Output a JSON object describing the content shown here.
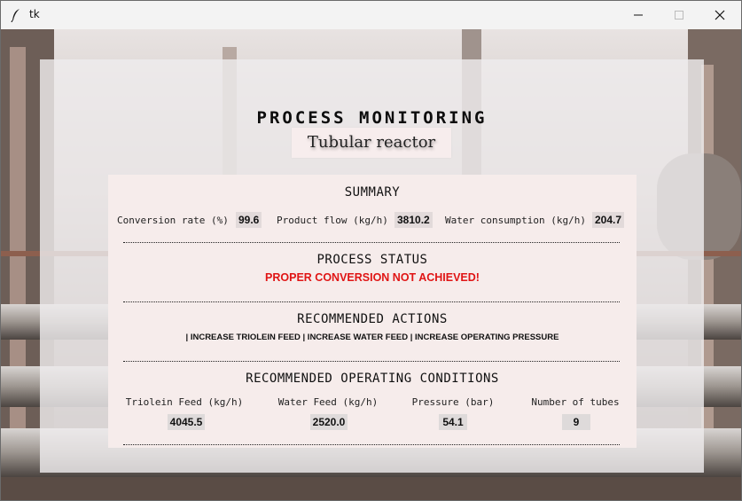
{
  "window": {
    "title": "tk"
  },
  "header": {
    "title": "PROCESS MONITORING",
    "reactor": "Tubular reactor"
  },
  "summary": {
    "title": "SUMMARY",
    "conversion_label": "Conversion rate (%)",
    "conversion_value": "99.6",
    "product_label": "Product flow (kg/h)",
    "product_value": "3810.2",
    "water_label": "Water consumption (kg/h)",
    "water_value": "204.7"
  },
  "status": {
    "title": "PROCESS STATUS",
    "message": "PROPER CONVERSION NOT ACHIEVED!"
  },
  "actions": {
    "title": "RECOMMENDED ACTIONS",
    "text": "| INCREASE TRIOLEIN FEED | INCREASE WATER FEED | INCREASE OPERATING PRESSURE"
  },
  "conditions": {
    "title": "RECOMMENDED OPERATING CONDITIONS",
    "items": [
      {
        "label": "Triolein Feed (kg/h)",
        "value": "4045.5"
      },
      {
        "label": "Water Feed (kg/h)",
        "value": "2520.0"
      },
      {
        "label": "Pressure (bar)",
        "value": "54.1"
      },
      {
        "label": "Number of tubes",
        "value": "9"
      }
    ]
  },
  "colors": {
    "status_alert": "#e01515",
    "card_bg": "#f6eceb",
    "value_bg": "#e2dada"
  },
  "icons": {
    "app": "feather-icon",
    "minimize": "minimize-icon",
    "maximize": "maximize-icon",
    "close": "close-icon"
  }
}
